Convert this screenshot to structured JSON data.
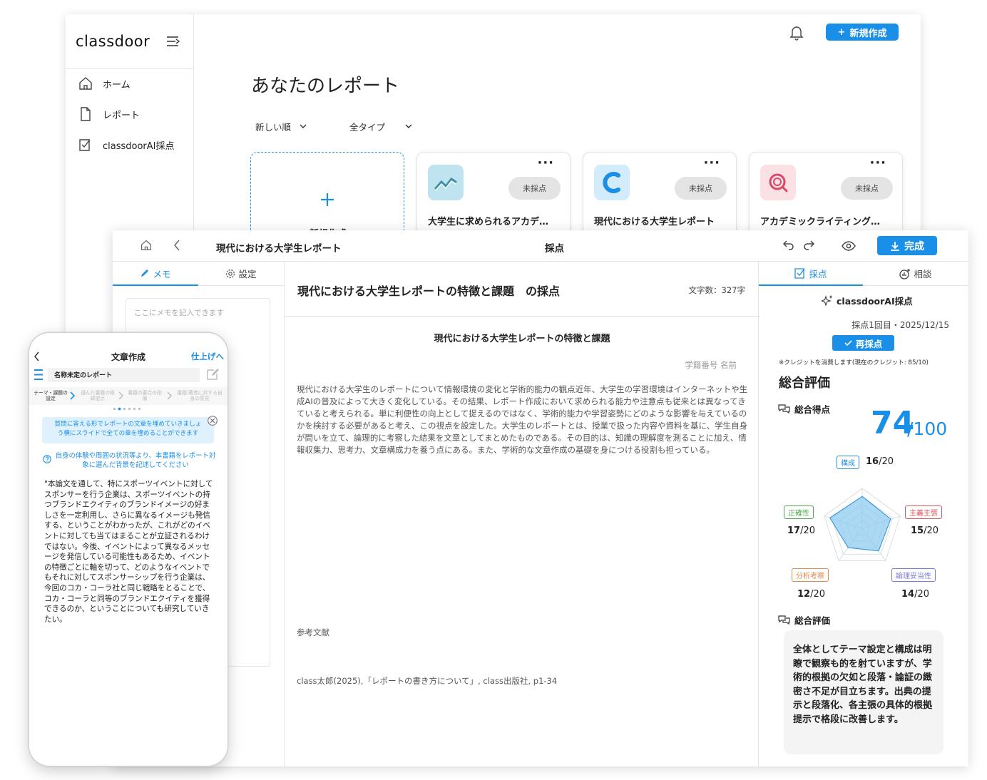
{
  "back_window": {
    "logo": "classdoor",
    "nav": [
      "ホーム",
      "レポート",
      "classdoorAI採点"
    ],
    "new_button": "新規作成",
    "page_title": "あなたのレポート",
    "sort": "新しい順",
    "type_filter": "全タイプ",
    "new_card_label": "新規作成",
    "cards": [
      {
        "title": "大学生に求められるアカデ…",
        "status": "未採点",
        "icon": "chart-line-icon",
        "icon_bg": "#bfe3ef"
      },
      {
        "title": "現代における大学生レポート",
        "status": "未採点",
        "icon": "c-letter-icon",
        "icon_bg": "#d3ecfb"
      },
      {
        "title": "アカデミックライティング…",
        "status": "未採点",
        "icon": "magnifier-icon",
        "icon_bg": "#fbe1e4"
      }
    ]
  },
  "main_window": {
    "doc_title": "現代における大学生レポート",
    "mode": "採点",
    "done_button": "完成",
    "left_tabs": {
      "memo": "メモ",
      "settings": "設定"
    },
    "memo_placeholder": "ここにメモを記入できます",
    "paper": {
      "heading": "現代における大学生レポートの特徴と課題　の採点",
      "word_count": "文字数：327字",
      "doc_title": "現代における大学生レポートの特徴と課題",
      "student_id": "学籍番号 名前",
      "body": "現代における大学生のレポートについて情報環境の変化と学術的能力の観点近年、大学生の学習環境はインターネットや生成AIの普及によって大きく変化している。その結果、レポート作成において求められる能力や注意点も従来とは異なってきていると考えられる。単に利便性の向上として捉えるのではなく、学術的能力や学習姿勢にどのような影響を与えているのかを検討する必要があると考え、この視点を設定した。大学生のレポートとは、授業で扱った内容や資料を基に、学生自身が問いを立て、論理的に考察した結果を文章としてまとめたものである。その目的は、知識の理解度を測ることに加え、情報収集力、思考力、文章構成力を養う点にある。また、学術的な文章作成の基礎を身につける役割も担っている。",
      "references_title": "参考文献",
      "reference": "class太郎(2025),「レポートの書き方について」, class出版社, p1-34"
    },
    "right_panel": {
      "tabs": {
        "grading": "採点",
        "consult": "相談"
      },
      "ai_label": "classdoorAI採点",
      "grading_info": "採点1回目・2025/12/15",
      "regrade_button": "再採点",
      "credit_note": "※クレジットを消費します(現在のクレジット: 85/10)",
      "overall_title": "総合評価",
      "total_label": "総合得点",
      "score": "74",
      "score_max": "/100",
      "criteria": [
        {
          "label": "構成",
          "score": "16",
          "max": "/20",
          "color": "#2a8fd8"
        },
        {
          "label": "主義主張",
          "score": "15",
          "max": "/20",
          "color": "#e0525a"
        },
        {
          "label": "論理妥当性",
          "score": "14",
          "max": "/20",
          "color": "#7a7ad8"
        },
        {
          "label": "分析考察",
          "score": "12",
          "max": "/20",
          "color": "#e08a4a"
        },
        {
          "label": "正確性",
          "score": "17",
          "max": "/20",
          "color": "#4caa4c"
        }
      ],
      "comment_title": "総合評価",
      "comment": "全体としてテーマ設定と構成は明瞭で観察も的を射ていますが、学術的根拠の欠如と段落・論証の緻密さ不足が目立ちます。出典の提示と段落化、各主張の具体的根拠提示で格段に改善します。"
    }
  },
  "phone": {
    "title": "文章作成",
    "finish": "仕上げへ",
    "doc_name": "名称未定のレポート",
    "steps": [
      "テーマ・課題の設定",
      "選んだ書籍の経緯提示",
      "書籍の要点の指摘",
      "書籍/著者に対する自身の意見"
    ],
    "banner": "質問に答える形でレポートの文章を埋めていきましょう横にスライドで全ての章を埋めることができます",
    "question": "自身の体験や周囲の状況等より、本書籍をレポート対象に選んだ背景を記述してください",
    "text": "\"本論文を通して、特にスポーツイベントに対してスポンサーを行う企業は、スポーツイベントの持つブランドエクイティのブランドイメージの好ましさを一定利用し、さらに異なるイメージも発信する、ということがわかったが、これがどのイベントに対しても当てはまることが立証されるわけではない。今後、イベントによって異なるメッセージを発信している可能性もあるため、イベントの特徴ごとに軸を切って、どのようなイベントでもそれに対してスポンサーシップを行う企業は、今回のコカ・コーラ社と同じ戦略をとることで、コカ・コーラと同等のブランドエクイティを獲得できるのか、ということについても研究していきたい。"
  }
}
